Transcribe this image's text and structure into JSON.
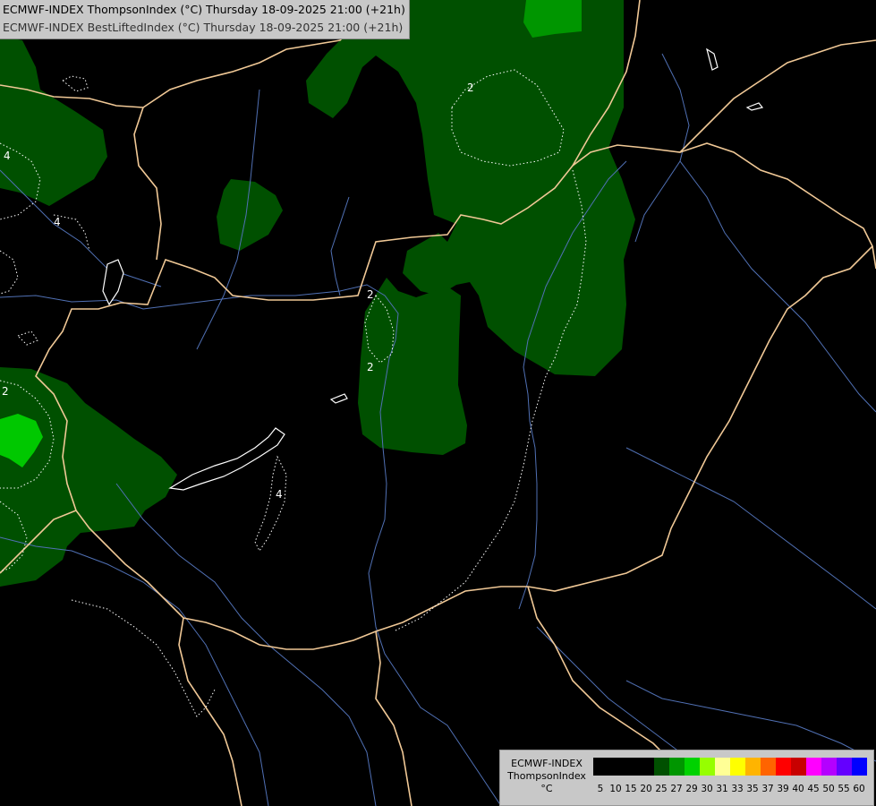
{
  "header": {
    "line1": "ECMWF-INDEX ThompsonIndex (°C) Thursday 18-09-2025 21:00 (+21h)",
    "line2": "ECMWF-INDEX BestLiftedIndex (°C) Thursday 18-09-2025 21:00 (+21h)"
  },
  "legend": {
    "title_line1": "ECMWF-INDEX",
    "title_line2": "ThompsonIndex",
    "unit": "°C",
    "ticks": [
      "5",
      "10",
      "15",
      "20",
      "25",
      "27",
      "29",
      "30",
      "31",
      "33",
      "35",
      "37",
      "39",
      "40",
      "45",
      "50",
      "55",
      "60"
    ],
    "colors": [
      "#000000",
      "#000000",
      "#000000",
      "#000000",
      "#005000",
      "#009600",
      "#00d200",
      "#96ff00",
      "#ffff96",
      "#ffff00",
      "#ffb400",
      "#ff6400",
      "#ff0000",
      "#c80000",
      "#ff00ff",
      "#b400ff",
      "#6400ff",
      "#0000ff"
    ]
  },
  "contour_labels": [
    "2",
    "4",
    "4",
    "2",
    "2",
    "2",
    "4"
  ],
  "colors": {
    "background": "#000000",
    "fill_dark_green": "#005000",
    "fill_mid_green": "#009600",
    "fill_bright_green": "#00c800",
    "border": "#f0c896",
    "river": "#5070b4",
    "contour": "#ffffff"
  }
}
